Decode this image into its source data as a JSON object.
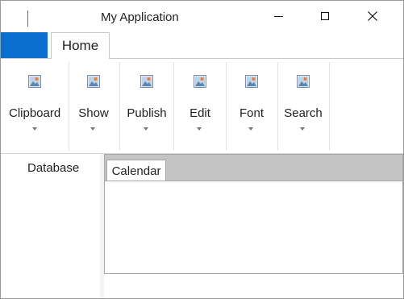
{
  "window": {
    "title": "My Application"
  },
  "ribbon": {
    "tabs": [
      {
        "label": "Home",
        "selected": true
      }
    ],
    "groups": [
      {
        "label": "Clipboard",
        "icon": "image-placeholder-icon"
      },
      {
        "label": "Show",
        "icon": "image-placeholder-icon"
      },
      {
        "label": "Publish",
        "icon": "image-placeholder-icon"
      },
      {
        "label": "Edit",
        "icon": "image-placeholder-icon"
      },
      {
        "label": "Font",
        "icon": "image-placeholder-icon"
      },
      {
        "label": "Search",
        "icon": "image-placeholder-icon"
      }
    ]
  },
  "left_panel": {
    "label": "Database"
  },
  "document": {
    "tabs": [
      {
        "label": "Calendar",
        "selected": true
      }
    ]
  },
  "colors": {
    "accent": "#0a6fcf",
    "tabstrip": "#c4c4c4",
    "border": "#a8a8a8"
  }
}
